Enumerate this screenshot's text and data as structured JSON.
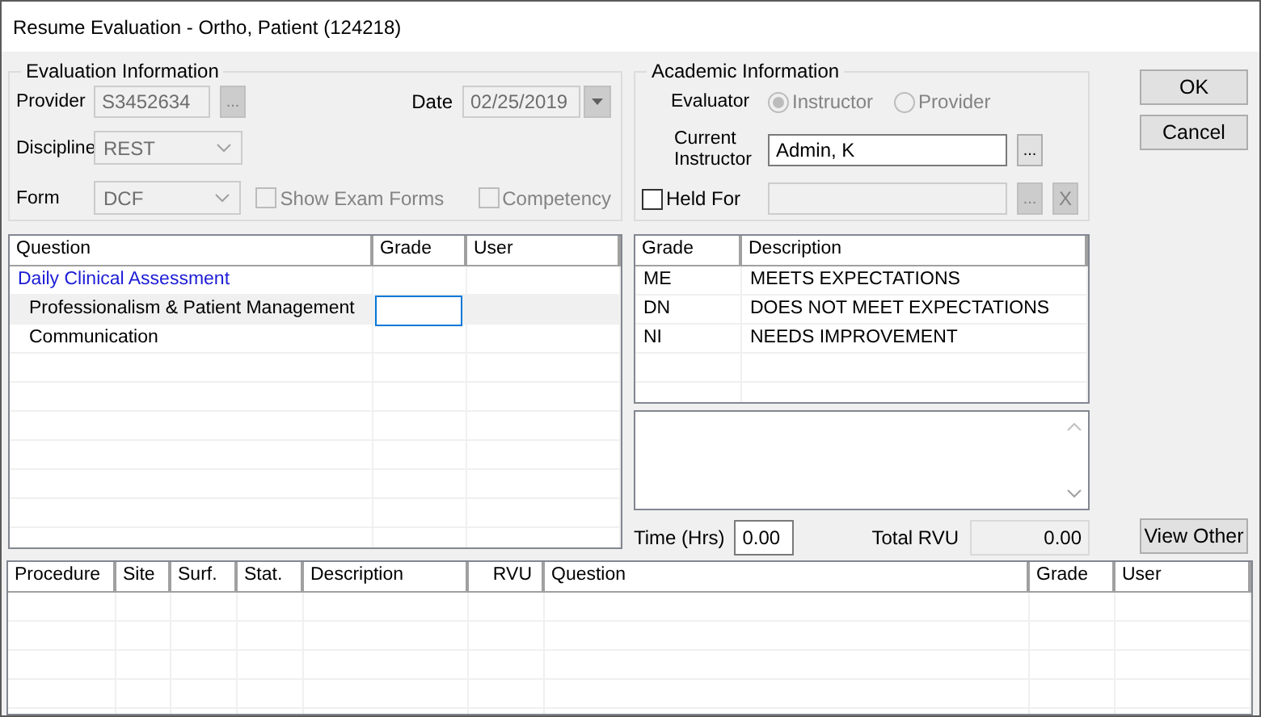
{
  "window": {
    "title": "Resume Evaluation - Ortho, Patient (124218)"
  },
  "evaluation_information": {
    "title": "Evaluation Information",
    "provider": {
      "label": "Provider",
      "value": "S3452634",
      "disabled": true,
      "browse": "..."
    },
    "date": {
      "label": "Date",
      "value": "02/25/2019",
      "disabled": true
    },
    "discipline": {
      "label": "Discipline",
      "value": "REST",
      "disabled": true
    },
    "form": {
      "label": "Form",
      "value": "DCF",
      "disabled": true
    },
    "checkboxes": [
      {
        "label": "Show Exam Forms",
        "checked": false,
        "disabled": true
      },
      {
        "label": "Competency",
        "checked": false,
        "disabled": true
      }
    ]
  },
  "academic_information": {
    "title": "Academic Information",
    "evaluator": {
      "label": "Evaluator",
      "options": [
        {
          "label": "Instructor",
          "selected": true,
          "disabled": true
        },
        {
          "label": "Provider",
          "selected": false,
          "disabled": true
        }
      ]
    },
    "current_instructor": {
      "label": "Current Instructor",
      "value": "Admin, K",
      "disabled": false,
      "browse": "..."
    },
    "held_for": {
      "label": "Held For",
      "checked": false,
      "disabled": true,
      "browse": "...",
      "clear": "X"
    }
  },
  "buttons": [
    "OK",
    "Cancel"
  ],
  "question_grid": {
    "columns": [
      "Question",
      "Grade",
      "User"
    ],
    "rows": [
      {
        "kind": "group",
        "question": "Daily Clinical Assessment",
        "selected": false
      },
      {
        "kind": "item",
        "question": "Professionalism & Patient Management",
        "selected": true
      },
      {
        "kind": "item",
        "question": "Communication",
        "selected": false
      }
    ]
  },
  "grade_grid": {
    "columns": [
      "Grade",
      "Description"
    ],
    "rows": [
      {
        "grade": "ME",
        "description": "MEETS EXPECTATIONS"
      },
      {
        "grade": "DN",
        "description": "DOES NOT MEET EXPECTATIONS"
      },
      {
        "grade": "NI",
        "description": "NEEDS IMPROVEMENT"
      }
    ]
  },
  "time": {
    "label": "Time (Hrs)",
    "value": "0.00"
  },
  "total_rvu": {
    "label": "Total RVU",
    "value": "0.00"
  },
  "view_other_button": "View Other",
  "procedure_grid": {
    "columns": [
      {
        "label": "Procedure"
      },
      {
        "label": "Site"
      },
      {
        "label": "Surf."
      },
      {
        "label": "Stat."
      },
      {
        "label": "Description"
      },
      {
        "label": "RVU"
      },
      {
        "label": "Question"
      },
      {
        "label": "Grade"
      },
      {
        "label": "User"
      }
    ]
  }
}
